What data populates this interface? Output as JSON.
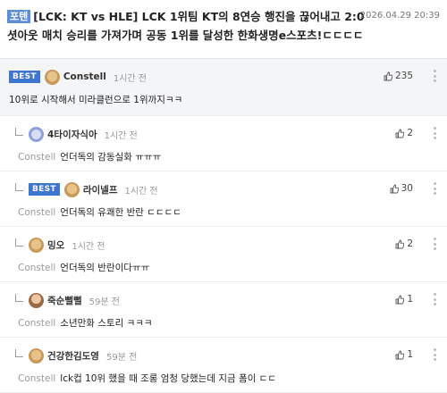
{
  "post": {
    "tag": "포텐",
    "title": "[LCK: KT vs HLE] LCK 1위팀 KT의 8연승 행진을 끊어내고 2:0 셧아웃 매치 승리를 가져가며 공동 1위를 달성한 한화생명e스포츠!ㄷㄷㄷㄷ",
    "date": "2026.04.29 20:39"
  },
  "best_label": "BEST",
  "comments": [
    {
      "type": "root",
      "best": true,
      "avatar": "dog",
      "nick": "Constell",
      "time": "1시간 전",
      "mention": "",
      "text": "10위로 시작해서 미라클런으로 1위까지ㅋㅋ",
      "likes": "235"
    },
    {
      "type": "reply",
      "best": false,
      "avatar": "plane",
      "nick": "4타이자식아",
      "time": "1시간 전",
      "mention": "Constell",
      "text": "언더독의 감동실화 ㅠㅠㅠ",
      "likes": "2"
    },
    {
      "type": "reply",
      "best": true,
      "avatar": "dog",
      "nick": "라이넬프",
      "time": "1시간 전",
      "mention": "Constell",
      "text": "언더독의 유쾌한 반란 ㄷㄷㄷㄷ",
      "likes": "30"
    },
    {
      "type": "reply",
      "best": false,
      "avatar": "dog",
      "nick": "밍오",
      "time": "1시간 전",
      "mention": "Constell",
      "text": "언더독의 반란이다ㅠㅠ",
      "likes": "2"
    },
    {
      "type": "reply",
      "best": false,
      "avatar": "person",
      "nick": "죽순뻘뻘",
      "time": "59분 전",
      "mention": "Constell",
      "text": "소년만화 스토리 ㅋㅋㅋ",
      "likes": "1"
    },
    {
      "type": "reply",
      "best": false,
      "avatar": "dog",
      "nick": "건강한김도영",
      "time": "59분 전",
      "mention": "Constell",
      "text": "lck컵 10위 했을 때 조롱 엄청 당했는데 지금 폼이 ㄷㄷ",
      "likes": "1"
    }
  ],
  "icons": {
    "like": "thumbs-up-icon",
    "more": "more-dots-icon",
    "reply": "reply-arrow-icon"
  },
  "colors": {
    "tag_bg": "#5d8fd8",
    "best_bg": "#3d75cf",
    "best_row_bg": "#f4f5f7"
  }
}
